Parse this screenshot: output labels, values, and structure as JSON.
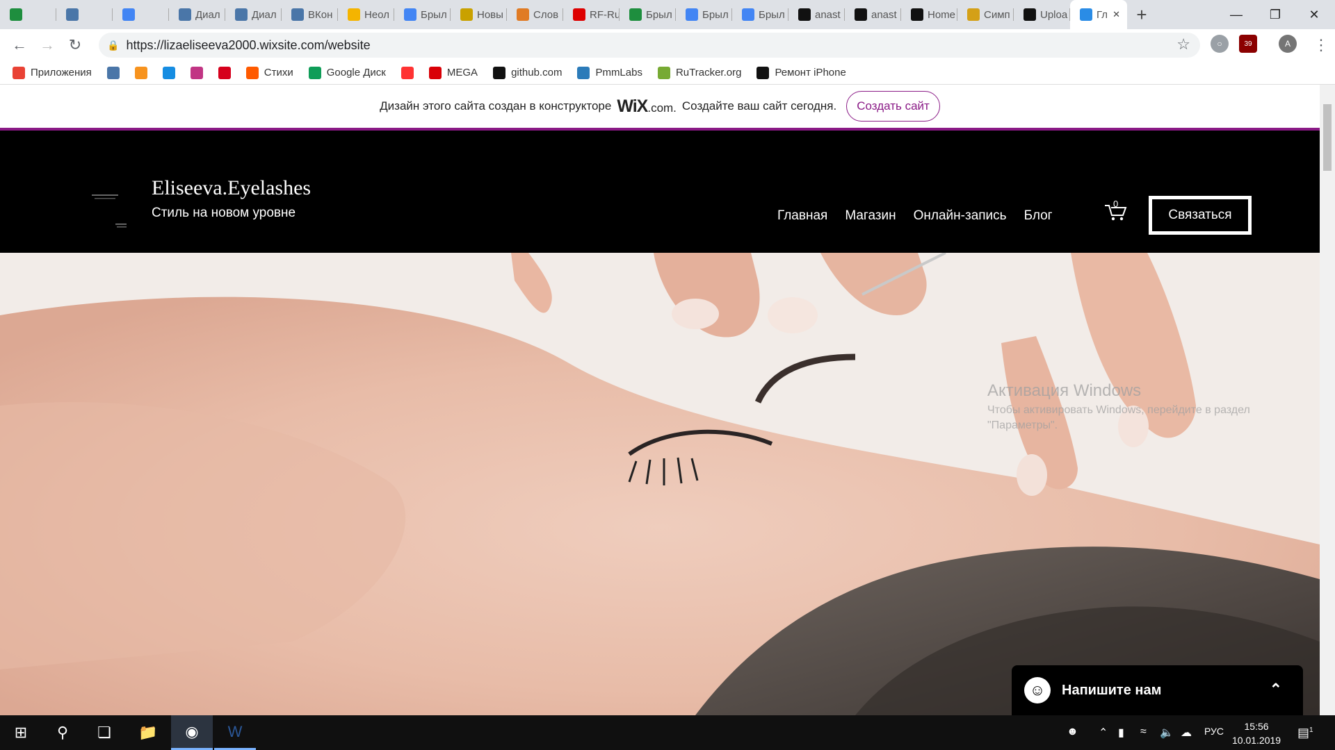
{
  "tabs": [
    {
      "label": "",
      "icon": "sheets-icon",
      "color": "#1e8e3e"
    },
    {
      "label": "",
      "icon": "vk-icon",
      "color": "#4a76a8"
    },
    {
      "label": "",
      "icon": "docs-icon",
      "color": "#4285f4"
    },
    {
      "label": "Диал",
      "icon": "chat-icon",
      "color": "#4a76a8"
    },
    {
      "label": "Диал",
      "icon": "chat-icon",
      "color": "#4a76a8"
    },
    {
      "label": "ВКон",
      "icon": "vk-icon",
      "color": "#4a76a8"
    },
    {
      "label": "Неол",
      "icon": "drive-icon",
      "color": "#f4b400"
    },
    {
      "label": "Брыл",
      "icon": "docs-icon",
      "color": "#4285f4"
    },
    {
      "label": "Новы",
      "icon": "wiki-icon",
      "color": "#c9a100"
    },
    {
      "label": "Слов",
      "icon": "book-icon",
      "color": "#e07b24"
    },
    {
      "label": "RF-Ru",
      "icon": "rf-icon",
      "color": "#d00"
    },
    {
      "label": "Брыл",
      "icon": "sheets-icon",
      "color": "#1e8e3e"
    },
    {
      "label": "Брыл",
      "icon": "docs-icon",
      "color": "#4285f4"
    },
    {
      "label": "Брыл",
      "icon": "docs-icon",
      "color": "#4285f4"
    },
    {
      "label": "anast",
      "icon": "github-icon",
      "color": "#111"
    },
    {
      "label": "anast",
      "icon": "github-icon",
      "color": "#111"
    },
    {
      "label": "Home",
      "icon": "github-icon",
      "color": "#111"
    },
    {
      "label": "Симп",
      "icon": "simpsons-icon",
      "color": "#d4a017"
    },
    {
      "label": "Uploa",
      "icon": "github-icon",
      "color": "#111"
    },
    {
      "label": "Гл",
      "icon": "wix-icon",
      "color": "#2a8ce6",
      "active": true
    }
  ],
  "address": {
    "url": "https://lizaeliseeva2000.wixsite.com/website"
  },
  "bookmarks": [
    {
      "label": "Приложения",
      "icon": "apps-icon",
      "color": "#e94235"
    },
    {
      "label": "",
      "icon": "vk-icon",
      "color": "#4a76a8"
    },
    {
      "label": "",
      "icon": "ok-icon",
      "color": "#f7931e"
    },
    {
      "label": "",
      "icon": "mail-icon",
      "color": "#168de2"
    },
    {
      "label": "",
      "icon": "instagram-icon",
      "color": "#c13584"
    },
    {
      "label": "",
      "icon": "hh-icon",
      "color": "#d6001c"
    },
    {
      "label": "Стихи",
      "icon": "poems-icon",
      "color": "#ff5a00"
    },
    {
      "label": "Google Диск",
      "icon": "drive-icon",
      "color": "#0f9d58"
    },
    {
      "label": "",
      "icon": "yandex-icon",
      "color": "#f33"
    },
    {
      "label": "MEGA",
      "icon": "mega-icon",
      "color": "#d90007"
    },
    {
      "label": "github.com",
      "icon": "github-icon",
      "color": "#111"
    },
    {
      "label": "PmmLabs",
      "icon": "flask-icon",
      "color": "#2b7bb9"
    },
    {
      "label": "RuTracker.org",
      "icon": "rutracker-icon",
      "color": "#7a3"
    },
    {
      "label": "Ремонт iPhone",
      "icon": "apple-icon",
      "color": "#111"
    }
  ],
  "extensions": {
    "badge": "39",
    "avatar": "A"
  },
  "wix_banner": {
    "text_before": "Дизайн этого сайта создан в конструкторе",
    "brand": "WiX",
    "brand_suffix": ".com.",
    "text_after": "Создайте ваш сайт сегодня.",
    "button": "Создать сайт"
  },
  "site": {
    "name": "Eliseeva.Eyelashes",
    "tagline": "Стиль на новом уровне",
    "menu": [
      "Главная",
      "Магазин",
      "Онлайн-запись",
      "Блог"
    ],
    "cart_count": "0",
    "contact_button": "Связаться"
  },
  "watermark": {
    "title": "Активация Windows",
    "line1": "Чтобы активировать Windows, перейдите в раздел",
    "line2": "\"Параметры\"."
  },
  "chat": {
    "label": "Напишите нам"
  },
  "taskbar": {
    "lang": "РУС",
    "time": "15:56",
    "date": "10.01.2019",
    "notifications": "1"
  }
}
